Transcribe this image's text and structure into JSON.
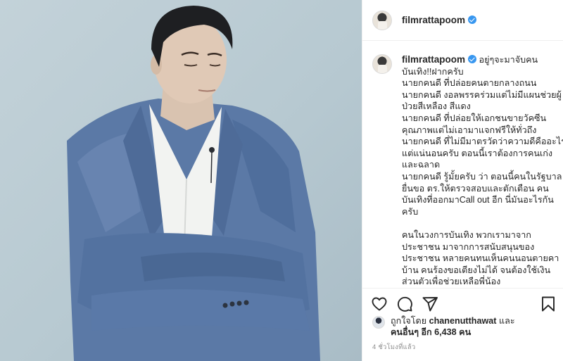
{
  "post": {
    "username": "filmrattapoom",
    "caption_first": "อยู่ๆจะมาจับคน",
    "caption_lines": [
      "บันเทิง!!ฝากครับ",
      "นายกคนดี ที่ปล่อยคนตายกลางถนน",
      "นายกคนดี งอลพรรคร่วมแต่ไม่มีแผนช่วยผู้",
      "ป่วยสีเหลือง สีแดง",
      "นายกคนดี ที่ปล่อยให้เอกชนขายวัคซีน",
      "คุณภาพแต่ไม่เอามาแจกฟรีให้ทั่วถึง",
      "นายกคนดี ที่ไม่มีมาตรวัดว่าความดีคืออะไร",
      "แต่แน่นอนครับ ตอนนี้เราต้องการคนเก่ง",
      "และฉลาด",
      "นายกคนดี รู้มั้ยครับ ว่า ตอนนี้คนในรัฐบาล",
      "ยื่นขอ ตร.ให้ตรวจสอบและตักเตือน คน",
      "บันเทิงที่ออกมาCall out อีก นี่มันอะไรกัน",
      "ครับ"
    ],
    "caption_lines_2": [
      "คนในวงการบันเทิง พวกเรามาจาก",
      "ประชาชน มาจากการสนับสนุนของ",
      "ประชาชน หลายคนทนเห็นคนนอนตายคา",
      "บ้าน คนร้องขอเตียงไม่ได้ จนต้องใช้เงิน",
      "ส่วนตัวเพื่อช่วยเหลือพี่น้อง"
    ],
    "likes_prefix": "ถูกใจโดย",
    "liked_by": "chanenutthawat",
    "likes_and": "และ",
    "likes_others": "คนอื่นๆ อีก 6,438 คน",
    "time_ago": "4 ชั่วโมงที่แล้ว"
  },
  "icons": [
    "heart-icon",
    "comment-icon",
    "share-icon",
    "bookmark-icon",
    "verified-badge-icon"
  ],
  "colors": {
    "verified": "#3897f0",
    "text": "#262626",
    "muted": "#8e8e8e",
    "border": "#efefef"
  }
}
